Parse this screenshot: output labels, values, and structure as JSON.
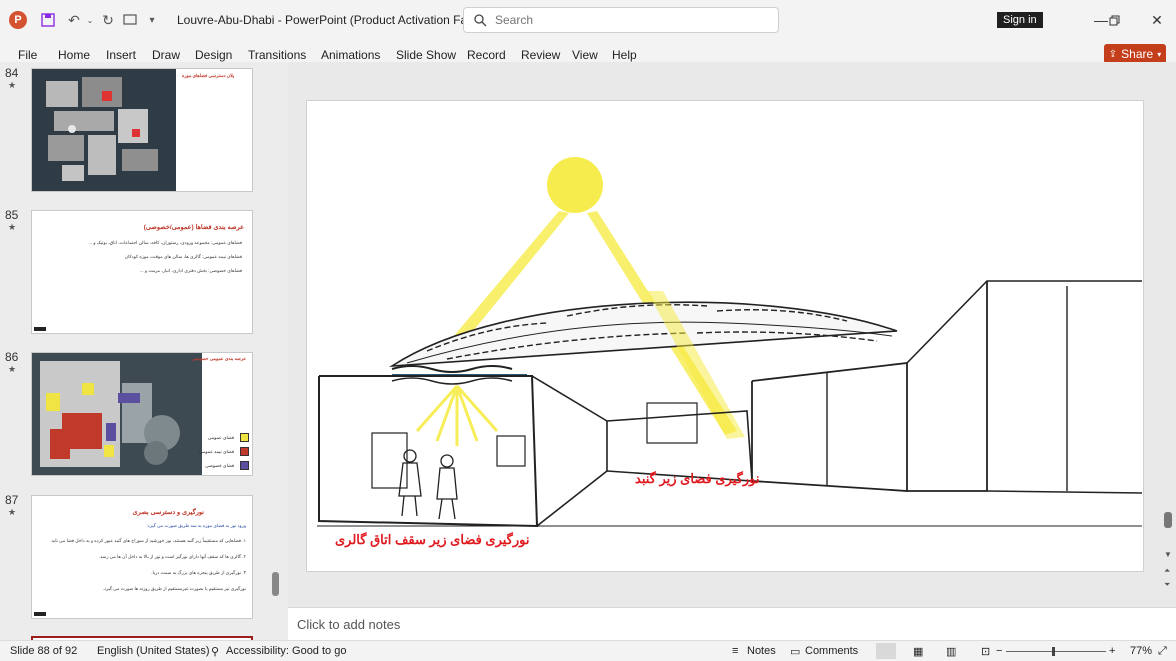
{
  "titlebar": {
    "app_icon": "P",
    "title": "Louvre-Abu-Dhabi  -  PowerPoint (Product Activation Fa...",
    "search_placeholder": "Search",
    "signin_label": "Sign in",
    "icons": [
      "save-icon",
      "undo-icon",
      "redo-icon",
      "customize-qat-icon",
      "search-icon",
      "minimize-icon",
      "restore-icon",
      "close-icon"
    ]
  },
  "menu": {
    "tabs": [
      "File",
      "Home",
      "Insert",
      "Draw",
      "Design",
      "Transitions",
      "Animations",
      "Slide Show",
      "Record",
      "Review",
      "View",
      "Help"
    ],
    "share_label": "Share"
  },
  "thumbnails": [
    {
      "number": "84",
      "star": "★",
      "title": "پلان دسترسی فضاهای موزه"
    },
    {
      "number": "85",
      "star": "★",
      "title": "عرصه بندی فضاها (عمومی/خصوصی)",
      "lines": [
        "فضاهای عمومی: مجموعه ورودی، رستوران، کافه، سالن اجتماعات، اتاق، بوتیک و ...",
        "فضاهای نیمه عمومی: گالری ها، سالن های موقت، موزه کودکان",
        "فضاهای خصوصی: بخش دفتری اداری، انبار، مرمت و ..."
      ]
    },
    {
      "number": "86",
      "star": "★",
      "title": "عرصه بندی عمومی خصوصی",
      "legend": [
        {
          "label": "فضای عمومی",
          "color": "#f0e442"
        },
        {
          "label": "فضای نیمه عمومی",
          "color": "#c0392b"
        },
        {
          "label": "فضای خصوصی",
          "color": "#5b4fa0"
        }
      ]
    },
    {
      "number": "87",
      "star": "★",
      "title": "نورگیری و دسترسی بصری",
      "lines": [
        "ورود نور به فضای موزه به سه طریق صورت می گیرد:",
        "۱. فضاهایی که مستقیماً زیر گنبد هستند، نور خورشید از سوراخ های گنبد عبور کرده و به داخل فضا می تابد.",
        "۲. گالری ها که سقف آنها دارای نورگیر است و نور از بالا به داخل آن ها می رسد.",
        "۳. نورگیری از طریق پنجره های بزرگ به سمت دریا.",
        "نورگیری نیز مستقیم یا بصورت غیرمستقیم از طریق روزنه ها صورت می گیرد."
      ]
    }
  ],
  "slide": {
    "caption_dome": "نورگیری فضای زیر گنبد",
    "caption_gallery": "نورگیری فضای زیر سقف اتاق گالری"
  },
  "notes": {
    "placeholder": "Click to add notes"
  },
  "status": {
    "slide_counter": "Slide 88 of 92",
    "language": "English (United States)",
    "accessibility": "Accessibility: Good to go",
    "notes_label": "Notes",
    "comments_label": "Comments",
    "zoom": "77%"
  }
}
